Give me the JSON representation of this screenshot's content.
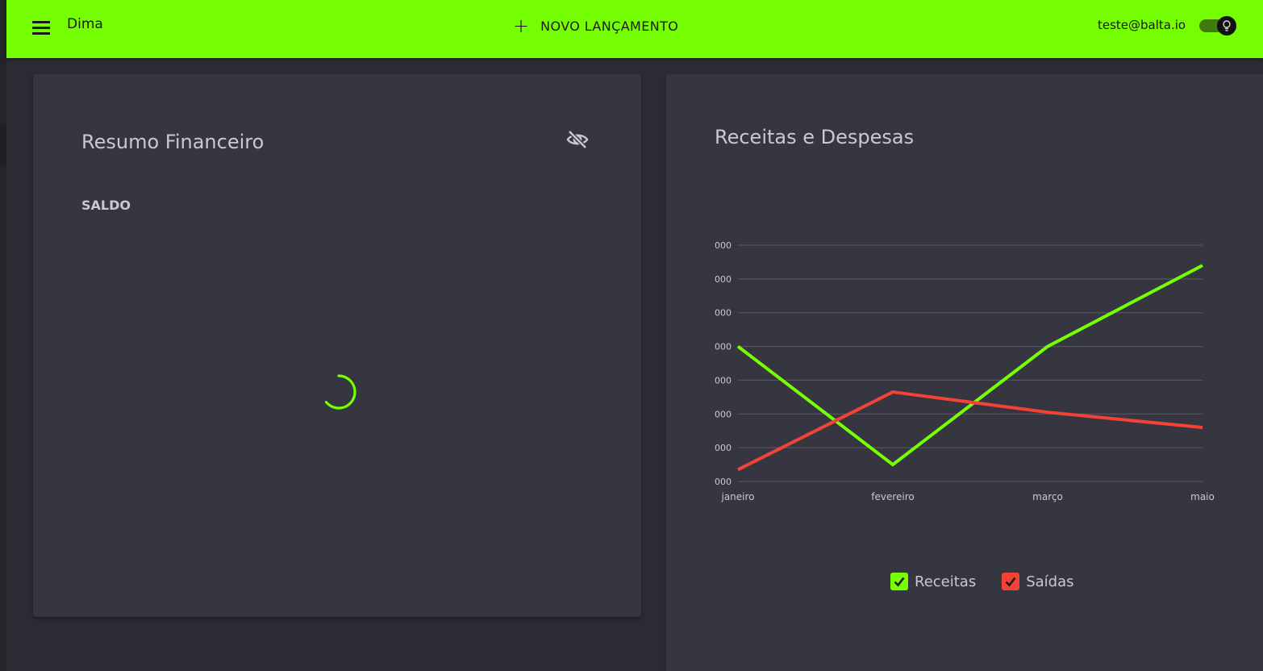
{
  "app": {
    "title": "Dima",
    "new_entry_label": "NOVO LANÇAMENTO",
    "user_email": "teste@balta.io",
    "accent": "#76ff03",
    "dark_mode_toggle": "on"
  },
  "summary": {
    "title": "Resumo Financeiro",
    "balance_label": "SALDO",
    "loading": true,
    "visibility_icon": "eye-off-icon"
  },
  "chart_card": {
    "title": "Receitas e Despesas"
  },
  "chart_data": {
    "type": "line",
    "title": "Receitas e Despesas",
    "categories": [
      "janeiro",
      "fevereiro",
      "março",
      "maio"
    ],
    "y_tick_labels": [
      "000",
      "000",
      "000",
      "000",
      "000",
      "000",
      "000",
      "000"
    ],
    "series": [
      {
        "name": "Receitas",
        "color": "#76ff03",
        "values": [
          4.0,
          0.5,
          4.0,
          6.4
        ]
      },
      {
        "name": "Saídas",
        "color": "#f44336",
        "values": [
          0.35,
          2.65,
          2.05,
          1.6
        ]
      }
    ],
    "ylim": [
      0,
      7
    ],
    "grid": true,
    "legend_position": "bottom"
  }
}
